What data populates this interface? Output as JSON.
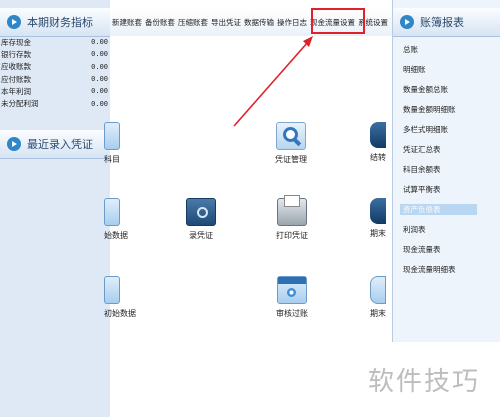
{
  "left_panel": {
    "finance_title": "本期财务指标",
    "rows": [
      {
        "label": "库存现金",
        "value": "0.00"
      },
      {
        "label": "银行存款",
        "value": "0.00"
      },
      {
        "label": "应收账款",
        "value": "0.00"
      },
      {
        "label": "应付账款",
        "value": "0.00"
      },
      {
        "label": "本年利润",
        "value": "0.00"
      },
      {
        "label": "未分配利润",
        "value": "0.00"
      }
    ],
    "recent_title": "最近录入凭证"
  },
  "toolbar": {
    "items": [
      "新建账套",
      "备份账套",
      "压缩账套",
      "导出凭证",
      "数据传输",
      "操作日志",
      "现金流量设置",
      "系统设置"
    ],
    "highlighted_item": "现金流量设置"
  },
  "main": {
    "tiles": [
      {
        "label": "科目"
      },
      {
        "label": "凭证管理"
      },
      {
        "label": "结转"
      },
      {
        "label": "始数据"
      },
      {
        "label": "录凭证"
      },
      {
        "label": "打印凭证"
      },
      {
        "label": "期末"
      },
      {
        "label": "初始数据"
      },
      {
        "label": "审核过账"
      },
      {
        "label": "期末"
      }
    ]
  },
  "right_panel": {
    "title": "账簿报表",
    "reports": [
      "总账",
      "明细账",
      "数量金额总账",
      "数量金额明细账",
      "多栏式明细账",
      "凭证汇总表",
      "科目余额表",
      "试算平衡表",
      "资产负债表",
      "利润表",
      "现金流量表",
      "现金流量明细表"
    ],
    "selected": "资产负债表"
  },
  "watermark": "软件技巧",
  "colors": {
    "highlight": "#e0212a",
    "accent": "#2f86c9",
    "selected_bg": "#b9d6f2"
  }
}
